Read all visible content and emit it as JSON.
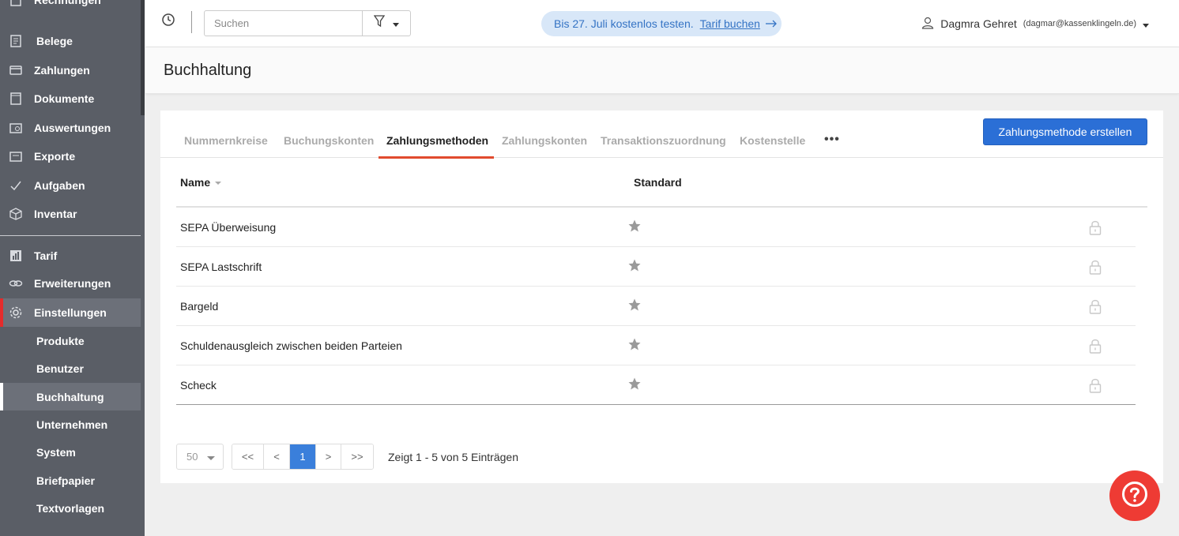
{
  "sidebar": {
    "items": [
      {
        "label": "Rechnungen",
        "icon": "invoice-icon"
      },
      {
        "label": "Belege",
        "icon": "receipt-icon"
      },
      {
        "label": "Zahlungen",
        "icon": "card-icon"
      },
      {
        "label": "Dokumente",
        "icon": "document-icon"
      },
      {
        "label": "Auswertungen",
        "icon": "report-icon"
      },
      {
        "label": "Exporte",
        "icon": "export-icon"
      },
      {
        "label": "Aufgaben",
        "icon": "check-icon"
      },
      {
        "label": "Inventar",
        "icon": "box-icon"
      },
      {
        "label": "Tarif",
        "icon": "chart-icon"
      },
      {
        "label": "Erweiterungen",
        "icon": "link-icon"
      },
      {
        "label": "Einstellungen",
        "icon": "gear-icon"
      }
    ],
    "sub_items": [
      {
        "label": "Produkte"
      },
      {
        "label": "Benutzer"
      },
      {
        "label": "Buchhaltung"
      },
      {
        "label": "Unternehmen"
      },
      {
        "label": "System"
      },
      {
        "label": "Briefpapier"
      },
      {
        "label": "Textvorlagen"
      }
    ]
  },
  "topbar": {
    "search_placeholder": "Suchen",
    "trial_text": "Bis 27. Juli kostenlos testen.",
    "trial_link": "Tarif buchen",
    "user_name": "Dagmra Gehret",
    "user_email": "(dagmar@kassenklingeln.de)"
  },
  "page": {
    "title": "Buchhaltung"
  },
  "tabs": [
    {
      "label": "Nummernkreise"
    },
    {
      "label": "Buchungskonten"
    },
    {
      "label": "Zahlungsmethoden"
    },
    {
      "label": "Zahlungskonten"
    },
    {
      "label": "Transaktionszuordnung"
    },
    {
      "label": "Kostenstelle"
    }
  ],
  "tabs_more": "•••",
  "create_button": "Zahlungsmethode erstellen",
  "table": {
    "headers": {
      "name": "Name",
      "standard": "Standard"
    },
    "rows": [
      {
        "name": "SEPA Überweisung"
      },
      {
        "name": "SEPA Lastschrift"
      },
      {
        "name": "Bargeld"
      },
      {
        "name": "Schuldenausgleich zwischen beiden Parteien"
      },
      {
        "name": "Scheck"
      }
    ]
  },
  "pagination": {
    "page_size": "50",
    "first": "<<",
    "prev": "<",
    "current": "1",
    "next": ">",
    "last": ">>",
    "info": "Zeigt 1 - 5 von 5 Einträgen"
  },
  "colors": {
    "sidebar_bg": "#5a5e66",
    "accent_blue": "#2b6fd6",
    "active_red": "#e52b2b",
    "help_red": "#ee3b34"
  }
}
